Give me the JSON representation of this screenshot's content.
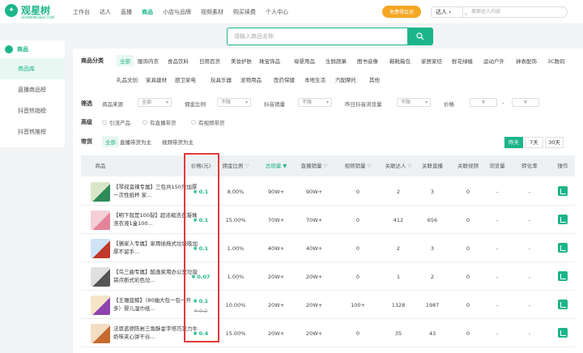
{
  "brand": {
    "name": "观星树",
    "sub": "GUANXINGSHU.COM"
  },
  "nav": [
    {
      "label": "工作台"
    },
    {
      "label": "达人"
    },
    {
      "label": "直播"
    },
    {
      "label": "商品",
      "active": true
    },
    {
      "label": "小店与品牌"
    },
    {
      "label": "视频素材"
    },
    {
      "label": "购买续费"
    },
    {
      "label": "个人中心"
    }
  ],
  "header": {
    "vip_label": "免费得会员",
    "search_type": "达人",
    "search_placeholder": "搜索达人内容"
  },
  "sidebar": {
    "title": "商品",
    "items": [
      {
        "label": "商品库",
        "active": true
      },
      {
        "label": "直播商品榜"
      },
      {
        "label": "抖音热销榜"
      },
      {
        "label": "抖音热推榜"
      }
    ]
  },
  "search": {
    "placeholder": "请输入商品名称"
  },
  "categories": {
    "label": "商品分类",
    "row1": [
      "全部",
      "服饰内衣",
      "食品饮料",
      "日用百货",
      "美妆护肤",
      "珠宝饰品",
      "母婴用品",
      "生鲜蔬果",
      "图书音像",
      "鞋靴箱包",
      "家居家纺",
      "鲜花绿植",
      "运动户外",
      "钟表配饰",
      "3C数码"
    ],
    "row2": [
      "礼品文创",
      "家具建材",
      "厨卫家电",
      "玩具乐器",
      "宠物用品",
      "医药保健",
      "本地生活",
      "汽配摩托",
      "其他"
    ]
  },
  "filters": {
    "label": "筛选",
    "source_label": "商品来源",
    "source_value": "全部",
    "commission_label": "佣金比例",
    "commission_value": "不限",
    "sales_label": "抖音销量",
    "sales_value": "不限",
    "yesterday_label": "昨日抖音浏览量",
    "yesterday_value": "不限",
    "price_label": "价格",
    "price_min": "¥",
    "price_max": "¥",
    "dash": "-"
  },
  "advanced": {
    "label": "高级",
    "options": [
      "引流产品",
      "有直播带货",
      "有视频带货"
    ]
  },
  "bring": {
    "label": "带货",
    "options": [
      "全部",
      "直播带货为主",
      "视频带货为主"
    ]
  },
  "days": [
    {
      "label": "昨天",
      "active": true
    },
    {
      "label": "7天"
    },
    {
      "label": "30天"
    }
  ],
  "table": {
    "headers": [
      "商品",
      "价格(元)",
      "佣金比例",
      "总销量",
      "直播销量",
      "视频销量",
      "关联达人",
      "关联直播",
      "关联视频",
      "浏览量",
      "转化率",
      "操作"
    ],
    "rows": [
      {
        "name": "【琴叔蛮辣专属】三包共150只加厚一次性纸杯 家...",
        "price": "¥ 0.1",
        "old": "",
        "commission": "8.00%",
        "total": "90W+",
        "live": "90W+",
        "video": "0",
        "kol": "2",
        "lives": "3",
        "videos": "0",
        "views": "-",
        "conv": "-",
        "c1": "#d9e6c8",
        "c2": "#2e8b57"
      },
      {
        "name": "【明下就是100裂】超浓缩洗衣凝珠洗衣液1盒100...",
        "price": "¥ 0.1",
        "old": "",
        "commission": "15.00%",
        "total": "70W+",
        "live": "70W+",
        "video": "0",
        "kol": "412",
        "lives": "656",
        "videos": "0",
        "views": "-",
        "conv": "-",
        "c1": "#f4cfd6",
        "c2": "#e4849a"
      },
      {
        "name": "【骆家人专属】家用插拖式垃圾吸加厚不留手...",
        "price": "¥ 0.1",
        "old": "",
        "commission": "1.00%",
        "total": "40W+",
        "live": "40W+",
        "video": "0",
        "kol": "2",
        "lives": "3",
        "videos": "0",
        "views": "-",
        "conv": "-",
        "c1": "#cfe3f5",
        "c2": "#c0392b"
      },
      {
        "name": "【鸟三曲专属】酷逸家用办公室垃圾袋点断式彩色垃...",
        "price": "¥ 0.07",
        "old": "",
        "commission": "1.00%",
        "total": "20W+",
        "live": "20W+",
        "video": "0",
        "kol": "1",
        "lives": "2",
        "videos": "0",
        "views": "-",
        "conv": "-",
        "c1": "#e0e0e0",
        "c2": "#555555"
      },
      {
        "name": "【王珊蓝鲸】（80抽大包一包一开多）婴儿湿巾纸...",
        "price": "¥ 0.1",
        "old": "¥ 0.2",
        "commission": "10.00%",
        "total": "20W+",
        "live": "20W+",
        "video": "100+",
        "kol": "1328",
        "lives": "1987",
        "videos": "0",
        "views": "-",
        "conv": "-",
        "c1": "#f5e6c8",
        "c2": "#8e44ad"
      },
      {
        "name": "法恩蓝德陈岩三角酥金字塔巧克力牛奶味夹心饼干谷...",
        "price": "¥ 0.4",
        "old": "",
        "commission": "15.00%",
        "total": "20W+",
        "live": "20W+",
        "video": "0",
        "kol": "35",
        "lives": "43",
        "videos": "0",
        "views": "-",
        "conv": "-",
        "c1": "#f3ddc3",
        "c2": "#c56b2e"
      }
    ]
  },
  "colors": {
    "accent": "#1cb589",
    "highlight": "#e03b3b",
    "vip": "#f5a623"
  }
}
